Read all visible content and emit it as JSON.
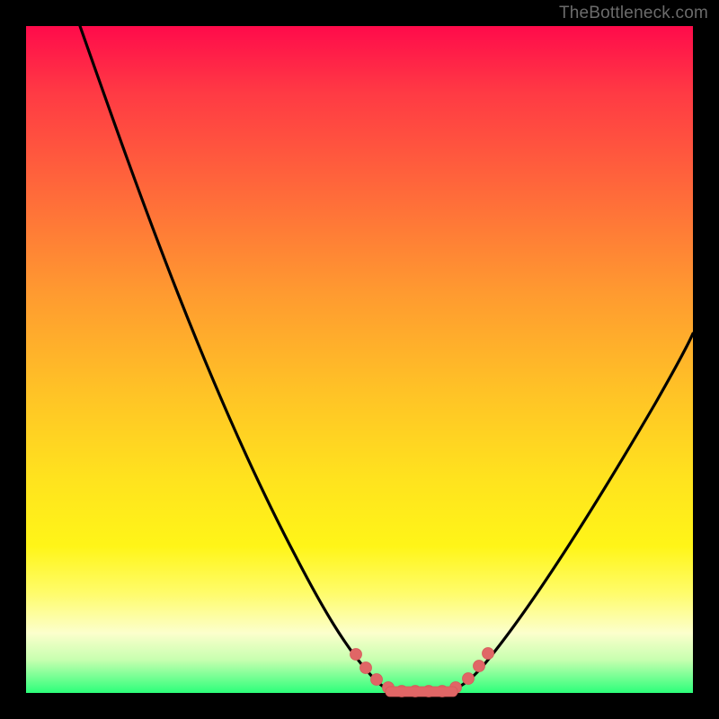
{
  "watermark": "TheBottleneck.com",
  "colors": {
    "frame": "#000000",
    "gradient_top": "#ff0b4b",
    "gradient_mid1": "#ff9a30",
    "gradient_mid2": "#ffe31e",
    "gradient_bottom": "#2cff7a",
    "curve": "#000000",
    "markers": "#e06666"
  },
  "chart_data": {
    "type": "line",
    "title": "",
    "xlabel": "",
    "ylabel": "",
    "xlim": [
      0,
      100
    ],
    "ylim": [
      0,
      100
    ],
    "series": [
      {
        "name": "left-branch",
        "x": [
          11,
          15,
          20,
          25,
          30,
          35,
          40,
          45,
          47,
          49,
          51,
          52
        ],
        "y": [
          100,
          85,
          68,
          52,
          38,
          26,
          16,
          8,
          5,
          3,
          1,
          0
        ]
      },
      {
        "name": "flat-valley",
        "x": [
          52,
          54,
          56,
          58,
          60,
          62,
          64
        ],
        "y": [
          0,
          0,
          0,
          0,
          0,
          0,
          0
        ]
      },
      {
        "name": "right-branch",
        "x": [
          64,
          66,
          68,
          71,
          76,
          82,
          88,
          94,
          100
        ],
        "y": [
          0,
          1,
          3,
          6,
          13,
          23,
          35,
          47,
          56
        ]
      }
    ],
    "markers": {
      "name": "highlighted-points",
      "points": [
        {
          "x": 48,
          "y": 4
        },
        {
          "x": 50,
          "y": 2
        },
        {
          "x": 52,
          "y": 0.5
        },
        {
          "x": 54,
          "y": 0
        },
        {
          "x": 56,
          "y": 0
        },
        {
          "x": 58,
          "y": 0
        },
        {
          "x": 60,
          "y": 0
        },
        {
          "x": 62,
          "y": 0
        },
        {
          "x": 64,
          "y": 0.5
        },
        {
          "x": 66,
          "y": 2
        },
        {
          "x": 68,
          "y": 4
        }
      ]
    }
  }
}
